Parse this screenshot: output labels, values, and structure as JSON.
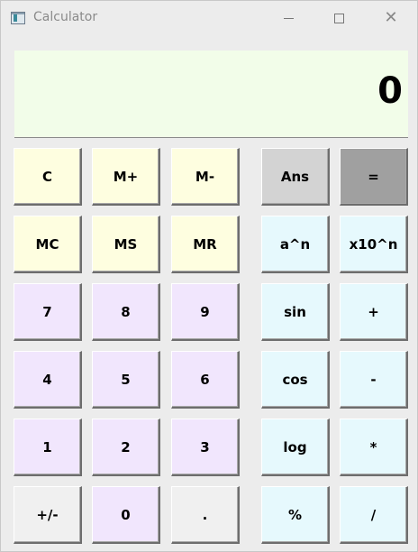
{
  "window": {
    "title": "Calculator"
  },
  "display": {
    "value": "0"
  },
  "colors": {
    "memory": "#fefee0",
    "digit": "#f1e6fd",
    "function": "#e6f9fd",
    "neutral": "#f0f0f0",
    "ans": "#d3d3d3",
    "equals": "#a0a0a0",
    "display_bg": "#f2fde9"
  },
  "buttons": [
    {
      "label": "C",
      "name": "clear-button",
      "color": "#fefee0"
    },
    {
      "label": "M+",
      "name": "memory-add-button",
      "color": "#fefee0"
    },
    {
      "label": "M-",
      "name": "memory-subtract-button",
      "color": "#fefee0"
    },
    {
      "label": "Ans",
      "name": "answer-button",
      "color": "#d3d3d3"
    },
    {
      "label": "=",
      "name": "equals-button",
      "color": "#a0a0a0"
    },
    {
      "label": "MC",
      "name": "memory-clear-button",
      "color": "#fefee0"
    },
    {
      "label": "MS",
      "name": "memory-store-button",
      "color": "#fefee0"
    },
    {
      "label": "MR",
      "name": "memory-recall-button",
      "color": "#fefee0"
    },
    {
      "label": "a^n",
      "name": "power-button",
      "color": "#e6f9fd"
    },
    {
      "label": "x10^n",
      "name": "exponent-button",
      "color": "#e6f9fd"
    },
    {
      "label": "7",
      "name": "digit-7-button",
      "color": "#f1e6fd"
    },
    {
      "label": "8",
      "name": "digit-8-button",
      "color": "#f1e6fd"
    },
    {
      "label": "9",
      "name": "digit-9-button",
      "color": "#f1e6fd"
    },
    {
      "label": "sin",
      "name": "sin-button",
      "color": "#e6f9fd"
    },
    {
      "label": "+",
      "name": "add-button",
      "color": "#e6f9fd"
    },
    {
      "label": "4",
      "name": "digit-4-button",
      "color": "#f1e6fd"
    },
    {
      "label": "5",
      "name": "digit-5-button",
      "color": "#f1e6fd"
    },
    {
      "label": "6",
      "name": "digit-6-button",
      "color": "#f1e6fd"
    },
    {
      "label": "cos",
      "name": "cos-button",
      "color": "#e6f9fd"
    },
    {
      "label": "-",
      "name": "subtract-button",
      "color": "#e6f9fd"
    },
    {
      "label": "1",
      "name": "digit-1-button",
      "color": "#f1e6fd"
    },
    {
      "label": "2",
      "name": "digit-2-button",
      "color": "#f1e6fd"
    },
    {
      "label": "3",
      "name": "digit-3-button",
      "color": "#f1e6fd"
    },
    {
      "label": "log",
      "name": "log-button",
      "color": "#e6f9fd"
    },
    {
      "label": "*",
      "name": "multiply-button",
      "color": "#e6f9fd"
    },
    {
      "label": "+/-",
      "name": "negate-button",
      "color": "#f0f0f0"
    },
    {
      "label": "0",
      "name": "digit-0-button",
      "color": "#f1e6fd"
    },
    {
      "label": ".",
      "name": "decimal-button",
      "color": "#f0f0f0"
    },
    {
      "label": "%",
      "name": "percent-button",
      "color": "#e6f9fd"
    },
    {
      "label": "/",
      "name": "divide-button",
      "color": "#e6f9fd"
    }
  ]
}
